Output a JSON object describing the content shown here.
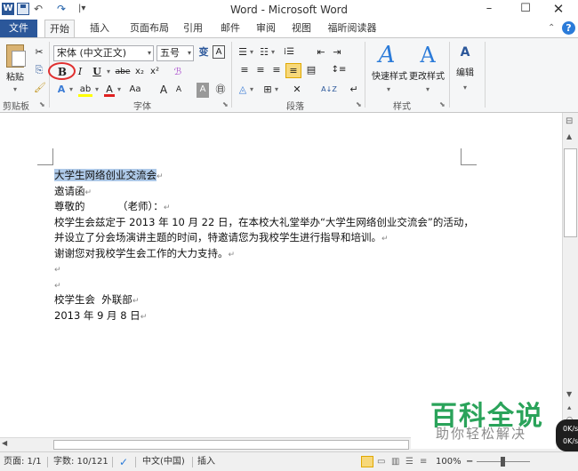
{
  "titlebar": {
    "app_logo": "W",
    "window_title": "Word - Microsoft Word",
    "undo_icon": "↶",
    "redo_icon": "↷",
    "customize_icon": "|▾",
    "minimize": "–",
    "maximize": "☐",
    "close": "✕"
  },
  "tabs": {
    "file": "文件",
    "home": "开始",
    "insert": "插入",
    "layout": "页面布局",
    "references": "引用",
    "mailings": "邮件",
    "review": "审阅",
    "view": "视图",
    "reader": "福昕阅读器",
    "collapse": "⌃",
    "help": "?"
  },
  "ribbon": {
    "clipboard": {
      "label": "剪贴板",
      "paste": "粘贴",
      "cut_icon": "✂",
      "copy_icon": "⎘",
      "format_painter_icon": "🖌"
    },
    "font": {
      "label": "字体",
      "font_name": "宋体 (中文正文)",
      "font_size": "五号",
      "grow": "A",
      "shrink": "A",
      "phonetic": "变",
      "border_char": "A",
      "bold": "B",
      "italic": "I",
      "underline": "U",
      "strike": "abe",
      "subscript": "x₂",
      "superscript": "x²",
      "clear": "ℬ",
      "text_effect": "A",
      "highlight": "ab",
      "font_color": "A",
      "change_case": "Aa",
      "grow2": "A",
      "shrink2": "A",
      "char_shade": "A",
      "enclose": "㊐",
      "highlight_color": "#ffff00",
      "font_color_value": "#e02020"
    },
    "paragraph": {
      "label": "段落",
      "bullets": "☰",
      "numbering": "☷",
      "multilevel": "⁞☰",
      "decrease_indent": "⇤",
      "increase_indent": "⇥",
      "align_left": "≡",
      "align_center": "≡",
      "align_right": "≡",
      "justify": "≡",
      "distributed": "▤",
      "line_spacing": "↕≡",
      "shading": "◬",
      "borders": "⊞",
      "chinese_layout": "✕",
      "sort": "A↓Z",
      "show_marks": "↵"
    },
    "styles": {
      "label": "样式",
      "quick_styles": "快速样式",
      "change_styles": "更改样式"
    },
    "editing": {
      "label": "编辑",
      "find_icon": "🔍"
    }
  },
  "document": {
    "paragraphs": [
      {
        "text": "大学生网络创业交流会",
        "highlighted": true
      },
      {
        "text": "邀请函",
        "highlighted": false
      },
      {
        "text": "尊敬的          （老师）：",
        "highlighted": false
      },
      {
        "text": "校学生会兹定于 2013 年 10 月 22 日，在本校大礼堂举办“大学生网络创业交流会”的活动，",
        "highlighted": false,
        "no_mark": true
      },
      {
        "text": "并设立了分会场演讲主题的时间，特邀请您为我校学生进行指导和培训。",
        "highlighted": false
      },
      {
        "text": "谢谢您对我校学生会工作的大力支持。",
        "highlighted": false
      },
      {
        "text": "",
        "highlighted": false
      },
      {
        "text": "",
        "highlighted": false
      },
      {
        "text": "校学生会  外联部",
        "highlighted": false
      },
      {
        "text": "2013 年 9 月 8 日",
        "highlighted": false
      }
    ],
    "para_mark": "↵"
  },
  "statusbar": {
    "page": "页面: 1/1",
    "words": "字数: 10/121",
    "language": "中文(中国)",
    "mode": "插入",
    "zoom": "100%",
    "zoom_out": "−",
    "zoom_in": "+"
  },
  "watermark": {
    "title": "百科全说",
    "subtitle": "助你轻松解决"
  },
  "net_widget": {
    "up": "0K/s",
    "down": "0K/s"
  }
}
